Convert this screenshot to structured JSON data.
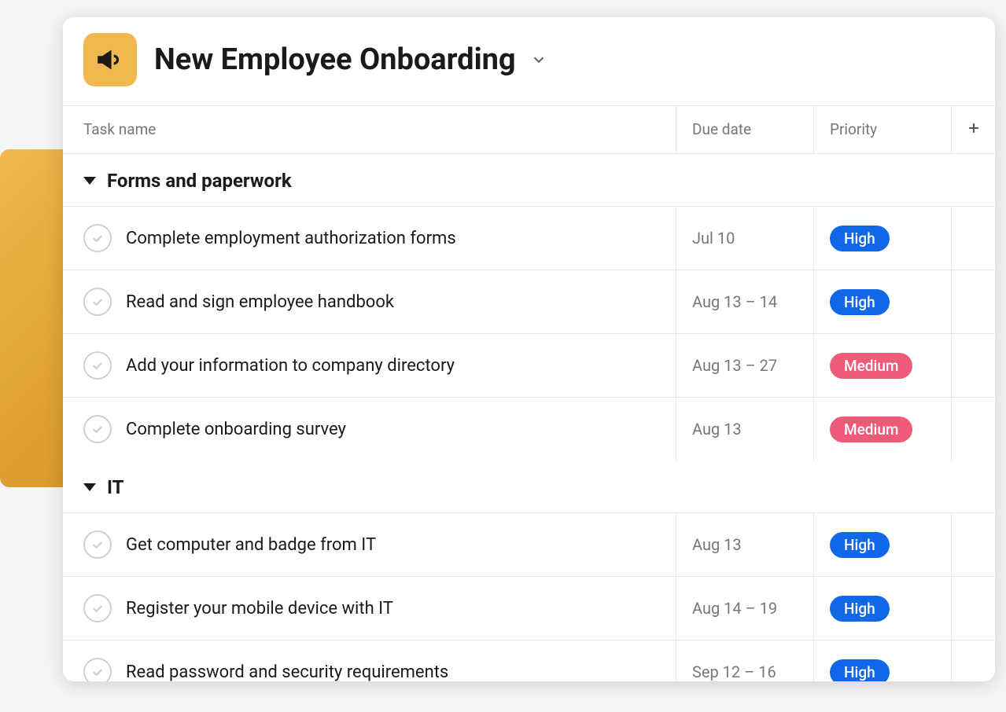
{
  "project": {
    "title": "New Employee Onboarding"
  },
  "columns": {
    "task": "Task name",
    "due": "Due date",
    "priority": "Priority"
  },
  "sections": [
    {
      "name": "Forms and paperwork",
      "tasks": [
        {
          "name": "Complete employment authorization forms",
          "due": "Jul 10",
          "priority": "High",
          "priority_class": "high"
        },
        {
          "name": "Read and sign employee handbook",
          "due": "Aug 13 – 14",
          "priority": "High",
          "priority_class": "high"
        },
        {
          "name": "Add your information to company directory",
          "due": "Aug 13 – 27",
          "priority": "Medium",
          "priority_class": "medium"
        },
        {
          "name": "Complete onboarding survey",
          "due": "Aug 13",
          "priority": "Medium",
          "priority_class": "medium"
        }
      ]
    },
    {
      "name": "IT",
      "tasks": [
        {
          "name": "Get computer and badge from IT",
          "due": "Aug 13",
          "priority": "High",
          "priority_class": "high"
        },
        {
          "name": "Register your mobile device with IT",
          "due": "Aug 14 – 19",
          "priority": "High",
          "priority_class": "high"
        },
        {
          "name": "Read password and security requirements",
          "due": "Sep 12 – 16",
          "priority": "High",
          "priority_class": "high"
        }
      ]
    }
  ]
}
